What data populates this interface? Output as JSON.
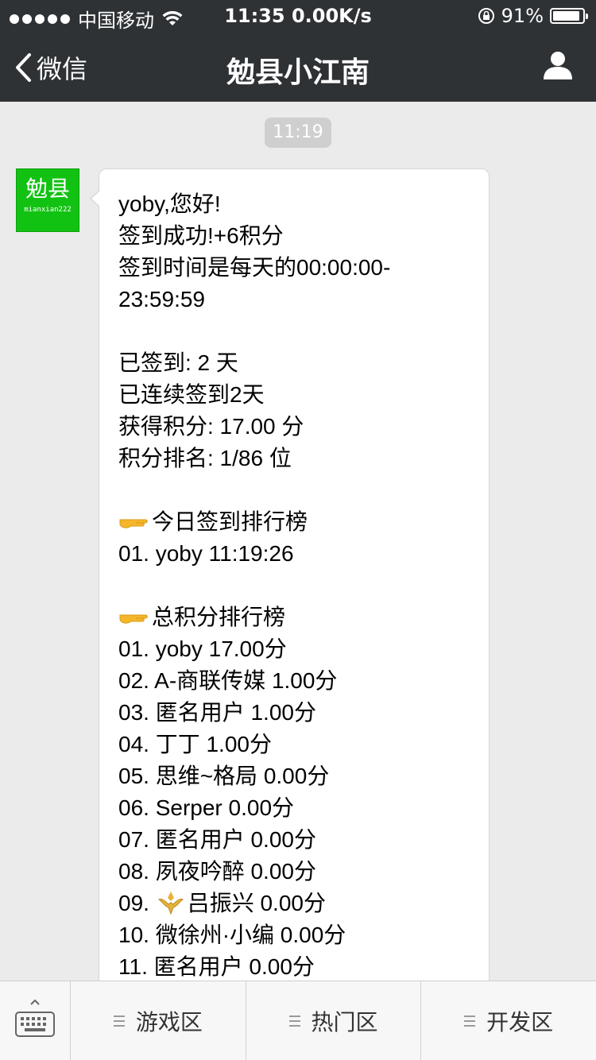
{
  "status_bar": {
    "carrier": "中国移动",
    "time": "11:35 0.00K/s",
    "battery": "91%",
    "battery_level": 0.91
  },
  "nav": {
    "back_label": "微信",
    "title": "勉县小江南"
  },
  "chat": {
    "timestamp": "11:19",
    "avatar": {
      "big": "勉县",
      "small": "mianxian222"
    },
    "message_lines": [
      "yoby,您好!",
      "签到成功!+6积分",
      "签到时间是每天的00:00:00-",
      "23:59:59",
      "",
      "已签到: 2 天",
      "已连续签到2天",
      "获得积分: 17.00 分",
      "积分排名: 1/86 位",
      "",
      "今日签到排行榜",
      "01. yoby 11:19:26",
      "",
      "总积分排行榜",
      "01. yoby 17.00分",
      "02. A-商联传媒 1.00分",
      "03. 匿名用户 1.00分",
      "04. 丁丁 1.00分",
      "05. 思维~格局 0.00分",
      "06. Serper 0.00分",
      "07. 匿名用户 0.00分",
      "08. 夙夜吟醉 0.00分",
      "09. 吕振兴 0.00分",
      "10. 微徐州·小编 0.00分",
      "11. 匿名用户 0.00分"
    ]
  },
  "menu": {
    "items": [
      "游戏区",
      "热门区",
      "开发区"
    ]
  },
  "colors": {
    "bar": "#2e3235",
    "chat_bg": "#ebebeb",
    "avatar_green": "#12c212",
    "finger_yellow": "#f5b62b"
  },
  "icons": [
    "back-chevron-icon",
    "profile-icon",
    "wifi-icon",
    "lock-rotation-icon",
    "battery-icon",
    "pointing-finger-icon",
    "fleur-emblem-icon",
    "keyboard-icon",
    "menu-list-icon"
  ]
}
